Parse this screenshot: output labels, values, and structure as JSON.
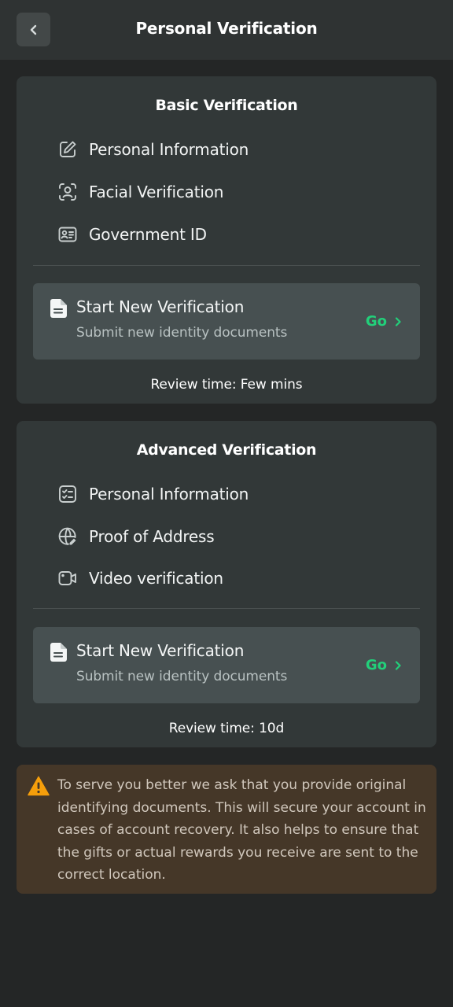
{
  "header": {
    "title": "Personal Verification"
  },
  "basic": {
    "title": "Basic Verification",
    "items": [
      {
        "label": "Personal Information",
        "icon": "edit-icon"
      },
      {
        "label": "Facial Verification",
        "icon": "face-scan-icon"
      },
      {
        "label": "Government ID",
        "icon": "id-card-icon"
      }
    ],
    "start": {
      "title": "Start New Verification",
      "subtitle": "Submit new identity documents",
      "go_label": "Go"
    },
    "review": "Review time: Few mins"
  },
  "advanced": {
    "title": "Advanced Verification",
    "items": [
      {
        "label": "Personal Information",
        "icon": "checklist-icon"
      },
      {
        "label": "Proof of Address",
        "icon": "globe-edit-icon"
      },
      {
        "label": "Video verification",
        "icon": "video-camera-icon"
      }
    ],
    "start": {
      "title": "Start New Verification",
      "subtitle": "Submit new identity documents",
      "go_label": "Go"
    },
    "review": "Review time: 10d"
  },
  "notice": {
    "text": "To serve you better we ask that you provide original identifying documents. This will secure your account in cases of account recovery. It also helps to ensure that the gifts or actual rewards you receive are sent to the correct location."
  },
  "colors": {
    "accent": "#22d07a",
    "warning": "#f59e0b",
    "background": "#242626",
    "card": "#323838"
  }
}
